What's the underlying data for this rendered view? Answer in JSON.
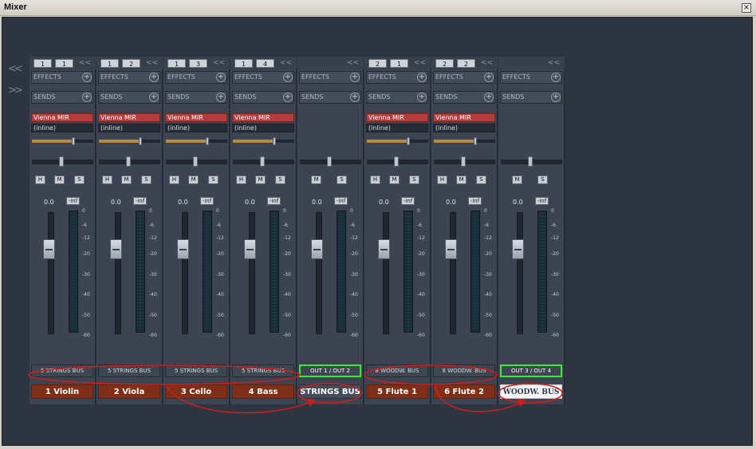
{
  "window": {
    "title": "Mixer",
    "close_glyph": "×"
  },
  "sidebar": {
    "collapse_label": "<<",
    "expand_label": ">>"
  },
  "strip_labels": {
    "effects": "EFFECTS",
    "sends": "SENDS",
    "plus": "+",
    "collapse_glyph": "<<",
    "h": "H",
    "m": "M",
    "s": "S"
  },
  "meter_ticks": [
    "0",
    "-6",
    "-12",
    "-20",
    "-30",
    "-40",
    "-50",
    "-60"
  ],
  "channels": [
    {
      "num1": "1",
      "num2": "1",
      "insert": "Vienna MIR",
      "inline": "(inline)",
      "has_insert": true,
      "has_h": true,
      "volume": "0.0",
      "peak": "-inf",
      "route": "5 STRINGS BUS",
      "route_green": false,
      "name": "1 Violin",
      "name_style": "track"
    },
    {
      "num1": "1",
      "num2": "2",
      "insert": "Vienna MIR",
      "inline": "(inline)",
      "has_insert": true,
      "has_h": true,
      "volume": "0.0",
      "peak": "-inf",
      "route": "5 STRINGS BUS",
      "route_green": false,
      "name": "2 Viola",
      "name_style": "track"
    },
    {
      "num1": "1",
      "num2": "3",
      "insert": "Vienna MIR",
      "inline": "(inline)",
      "has_insert": true,
      "has_h": true,
      "volume": "0.0",
      "peak": "-inf",
      "route": "5 STRINGS BUS",
      "route_green": false,
      "name": "3 Cello",
      "name_style": "track"
    },
    {
      "num1": "1",
      "num2": "4",
      "insert": "Vienna MIR",
      "inline": "(inline)",
      "has_insert": true,
      "has_h": true,
      "volume": "0.0",
      "peak": "-inf",
      "route": "5 STRINGS BUS",
      "route_green": false,
      "name": "4 Bass",
      "name_style": "track"
    },
    {
      "num1": "",
      "num2": "",
      "insert": "",
      "inline": "",
      "has_insert": false,
      "has_h": false,
      "volume": "0.0",
      "peak": "-inf",
      "route": "OUT 1 / OUT 2",
      "route_green": true,
      "name": "STRINGS BUS",
      "name_style": "bus"
    },
    {
      "num1": "2",
      "num2": "1",
      "insert": "Vienna MIR",
      "inline": "(inline)",
      "has_insert": true,
      "has_h": true,
      "volume": "0.0",
      "peak": "-inf",
      "route": "8 WOODW. BUS",
      "route_green": false,
      "name": "5 Flute 1",
      "name_style": "track"
    },
    {
      "num1": "2",
      "num2": "2",
      "insert": "Vienna MIR",
      "inline": "(inline)",
      "has_insert": true,
      "has_h": true,
      "volume": "0.0",
      "peak": "-inf",
      "route": "8 WOODW. BUS",
      "route_green": false,
      "name": "6 Flute 2",
      "name_style": "track"
    },
    {
      "num1": "",
      "num2": "",
      "insert": "",
      "inline": "",
      "has_insert": false,
      "has_h": false,
      "volume": "0.0",
      "peak": "-inf",
      "route": "OUT 3 / OUT 4",
      "route_green": true,
      "name": "WOODW. BUS",
      "name_style": "woodw"
    }
  ],
  "colors": {
    "accent_green": "#32ec38",
    "annotation_red": "#d61b1b",
    "track_red": "#b63d3d"
  }
}
